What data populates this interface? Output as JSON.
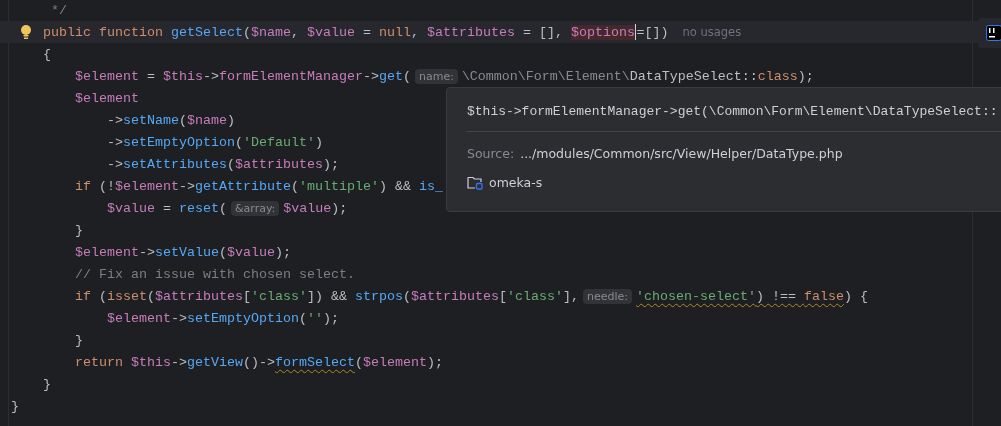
{
  "lines": [
    {
      "current": false,
      "bulb": false,
      "parts": [
        {
          "kind": "code",
          "tokens": [
            {
              "t": "     */",
              "kind": "comment"
            }
          ]
        }
      ]
    },
    {
      "current": true,
      "bulb": true,
      "parts": [
        {
          "kind": "code",
          "tokens": [
            {
              "t": "    public function ",
              "kind": "kw"
            },
            {
              "t": "getSelect",
              "kind": "fn"
            },
            {
              "t": "(",
              "kind": "plain"
            },
            {
              "t": "$name",
              "kind": "var"
            },
            {
              "t": ", ",
              "kind": "plain"
            },
            {
              "t": "$value",
              "kind": "var"
            },
            {
              "t": " = ",
              "kind": "plain"
            },
            {
              "t": "null",
              "kind": "kw"
            },
            {
              "t": ", ",
              "kind": "plain"
            },
            {
              "t": "$attributes",
              "kind": "var"
            },
            {
              "t": " = [], ",
              "kind": "plain"
            },
            {
              "t": "$options",
              "kind": "var",
              "highlighted": true,
              "caret": true
            },
            {
              "t": "=[])",
              "kind": "plain"
            }
          ]
        },
        {
          "kind": "note",
          "text": "no usages"
        }
      ]
    },
    {
      "current": false,
      "bulb": false,
      "parts": [
        {
          "kind": "code",
          "tokens": [
            {
              "t": "    {",
              "kind": "plain"
            }
          ]
        }
      ]
    },
    {
      "current": false,
      "bulb": false,
      "parts": [
        {
          "kind": "code",
          "tokens": [
            {
              "t": "        $element",
              "kind": "var"
            },
            {
              "t": " = ",
              "kind": "plain"
            },
            {
              "t": "$this",
              "kind": "var"
            },
            {
              "t": "->",
              "kind": "plain"
            },
            {
              "t": "formElementManager",
              "kind": "var"
            },
            {
              "t": "->",
              "kind": "plain"
            },
            {
              "t": "get",
              "kind": "fn"
            },
            {
              "t": "(",
              "kind": "plain"
            }
          ]
        },
        {
          "kind": "hint",
          "text": "name:"
        },
        {
          "kind": "code",
          "tokens": [
            {
              "t": "\\Common\\Form\\Element\\",
              "kind": "ns"
            },
            {
              "t": "DataTypeSelect::",
              "kind": "plain"
            },
            {
              "t": "class",
              "kind": "kw"
            },
            {
              "t": ");",
              "kind": "plain"
            }
          ]
        }
      ]
    },
    {
      "current": false,
      "bulb": false,
      "parts": [
        {
          "kind": "code",
          "tokens": [
            {
              "t": "        $element",
              "kind": "var"
            }
          ]
        }
      ]
    },
    {
      "current": false,
      "bulb": false,
      "parts": [
        {
          "kind": "code",
          "tokens": [
            {
              "t": "            ->",
              "kind": "plain"
            },
            {
              "t": "setName",
              "kind": "fn"
            },
            {
              "t": "(",
              "kind": "plain"
            },
            {
              "t": "$name",
              "kind": "var"
            },
            {
              "t": ")",
              "kind": "plain"
            }
          ]
        }
      ]
    },
    {
      "current": false,
      "bulb": false,
      "parts": [
        {
          "kind": "code",
          "tokens": [
            {
              "t": "            ->",
              "kind": "plain"
            },
            {
              "t": "setEmptyOption",
              "kind": "fn"
            },
            {
              "t": "(",
              "kind": "plain"
            },
            {
              "t": "'Default'",
              "kind": "str"
            },
            {
              "t": ")",
              "kind": "plain"
            }
          ]
        }
      ]
    },
    {
      "current": false,
      "bulb": false,
      "parts": [
        {
          "kind": "code",
          "tokens": [
            {
              "t": "            ->",
              "kind": "plain"
            },
            {
              "t": "setAttributes",
              "kind": "fn"
            },
            {
              "t": "(",
              "kind": "plain"
            },
            {
              "t": "$attributes",
              "kind": "var"
            },
            {
              "t": ");",
              "kind": "plain"
            }
          ]
        }
      ]
    },
    {
      "current": false,
      "bulb": false,
      "parts": [
        {
          "kind": "code",
          "tokens": [
            {
              "t": "        if ",
              "kind": "kw"
            },
            {
              "t": "(!",
              "kind": "plain"
            },
            {
              "t": "$element",
              "kind": "var"
            },
            {
              "t": "->",
              "kind": "plain"
            },
            {
              "t": "getAttribute",
              "kind": "fn"
            },
            {
              "t": "(",
              "kind": "plain"
            },
            {
              "t": "'multiple'",
              "kind": "str"
            },
            {
              "t": ") && ",
              "kind": "plain"
            },
            {
              "t": "is_",
              "kind": "fn"
            }
          ]
        }
      ]
    },
    {
      "current": false,
      "bulb": false,
      "parts": [
        {
          "kind": "code",
          "tokens": [
            {
              "t": "            $value",
              "kind": "var"
            },
            {
              "t": " = ",
              "kind": "plain"
            },
            {
              "t": "reset",
              "kind": "fn"
            },
            {
              "t": "(",
              "kind": "plain"
            }
          ]
        },
        {
          "kind": "hint",
          "text": "&array:"
        },
        {
          "kind": "code",
          "tokens": [
            {
              "t": "$value",
              "kind": "var"
            },
            {
              "t": ");",
              "kind": "plain"
            }
          ]
        }
      ]
    },
    {
      "current": false,
      "bulb": false,
      "parts": [
        {
          "kind": "code",
          "tokens": [
            {
              "t": "        }",
              "kind": "plain"
            }
          ]
        }
      ]
    },
    {
      "current": false,
      "bulb": false,
      "parts": [
        {
          "kind": "code",
          "tokens": [
            {
              "t": "        $element",
              "kind": "var"
            },
            {
              "t": "->",
              "kind": "plain"
            },
            {
              "t": "setValue",
              "kind": "fn"
            },
            {
              "t": "(",
              "kind": "plain"
            },
            {
              "t": "$value",
              "kind": "var"
            },
            {
              "t": ");",
              "kind": "plain"
            }
          ]
        }
      ]
    },
    {
      "current": false,
      "bulb": false,
      "parts": [
        {
          "kind": "code",
          "tokens": [
            {
              "t": "        // Fix an issue with chosen select.",
              "kind": "comment"
            }
          ]
        }
      ]
    },
    {
      "current": false,
      "bulb": false,
      "parts": [
        {
          "kind": "code",
          "tokens": [
            {
              "t": "        if ",
              "kind": "kw"
            },
            {
              "t": "(",
              "kind": "plain"
            },
            {
              "t": "isset",
              "kind": "kw"
            },
            {
              "t": "(",
              "kind": "plain"
            },
            {
              "t": "$attributes",
              "kind": "var"
            },
            {
              "t": "[",
              "kind": "plain"
            },
            {
              "t": "'class'",
              "kind": "str"
            },
            {
              "t": "]) && ",
              "kind": "plain"
            },
            {
              "t": "strpos",
              "kind": "fn"
            },
            {
              "t": "(",
              "kind": "plain"
            },
            {
              "t": "$attributes",
              "kind": "var"
            },
            {
              "t": "[",
              "kind": "plain"
            },
            {
              "t": "'class'",
              "kind": "str"
            },
            {
              "t": "],",
              "kind": "plain"
            }
          ]
        },
        {
          "kind": "hint",
          "text": "needle:"
        },
        {
          "kind": "code",
          "tokens": [
            {
              "t": "'chosen-select'",
              "kind": "str",
              "warning": true
            },
            {
              "t": ") !== ",
              "kind": "plain",
              "warning": true
            },
            {
              "t": "false",
              "kind": "kw",
              "warning": true
            },
            {
              "t": ") {",
              "kind": "plain"
            }
          ]
        }
      ]
    },
    {
      "current": false,
      "bulb": false,
      "parts": [
        {
          "kind": "code",
          "tokens": [
            {
              "t": "            $element",
              "kind": "var"
            },
            {
              "t": "->",
              "kind": "plain"
            },
            {
              "t": "setEmptyOption",
              "kind": "fn"
            },
            {
              "t": "(",
              "kind": "plain"
            },
            {
              "t": "''",
              "kind": "str"
            },
            {
              "t": ");",
              "kind": "plain"
            }
          ]
        }
      ]
    },
    {
      "current": false,
      "bulb": false,
      "parts": [
        {
          "kind": "code",
          "tokens": [
            {
              "t": "        }",
              "kind": "plain"
            }
          ]
        }
      ]
    },
    {
      "current": false,
      "bulb": false,
      "parts": [
        {
          "kind": "code",
          "tokens": [
            {
              "t": "        return ",
              "kind": "kw"
            },
            {
              "t": "$this",
              "kind": "var"
            },
            {
              "t": "->",
              "kind": "plain"
            },
            {
              "t": "getView",
              "kind": "fn"
            },
            {
              "t": "()->",
              "kind": "plain"
            },
            {
              "t": "formSelect",
              "kind": "fn",
              "warning": true
            },
            {
              "t": "(",
              "kind": "plain"
            },
            {
              "t": "$element",
              "kind": "var"
            },
            {
              "t": ");",
              "kind": "plain"
            }
          ]
        }
      ]
    },
    {
      "current": false,
      "bulb": false,
      "parts": [
        {
          "kind": "code",
          "tokens": [
            {
              "t": "    }",
              "kind": "plain"
            }
          ]
        }
      ]
    },
    {
      "current": false,
      "bulb": false,
      "parts": [
        {
          "kind": "code",
          "tokens": [
            {
              "t": "}",
              "kind": "plain"
            }
          ]
        }
      ]
    }
  ],
  "popup": {
    "code": "$this->formElementManager->get(\\Common\\Form\\Element\\DataTypeSelect::",
    "source_label": "Source:",
    "source_path": ".../modules/Common/src/View/Helper/DataType.php",
    "project": "omeka-s"
  }
}
